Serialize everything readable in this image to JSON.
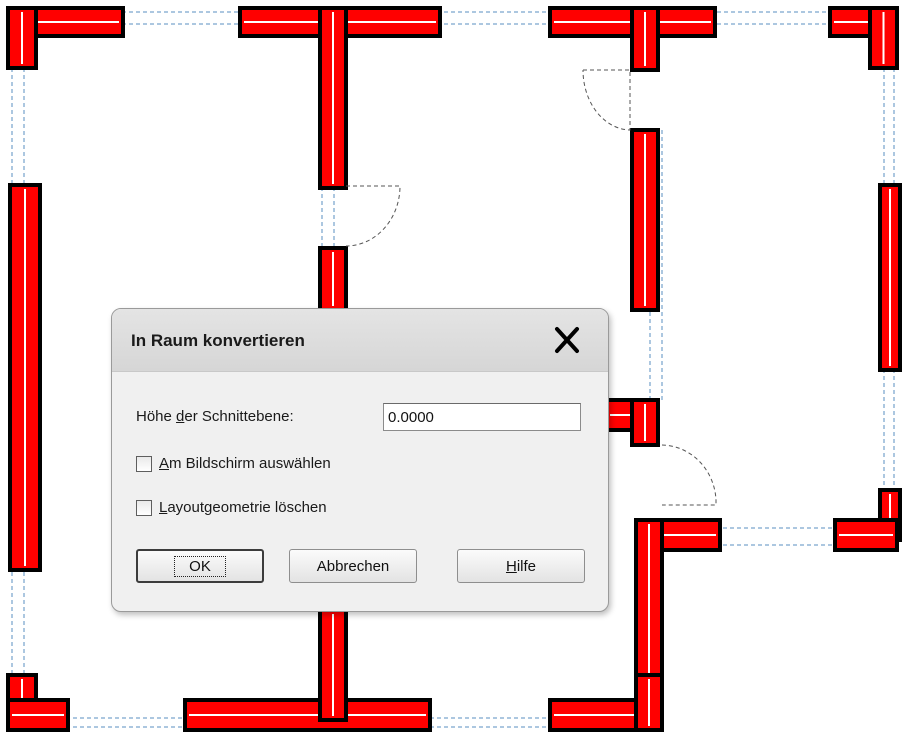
{
  "dialog": {
    "title": "In Raum konvertieren",
    "close_icon": "close-x-icon",
    "height_label_pre": "Höhe ",
    "height_label_u": "d",
    "height_label_post": "er Schnittebene:",
    "height_value": "0.0000",
    "select_on_screen_u": "A",
    "select_on_screen_rest": "m Bildschirm auswählen",
    "delete_layout_u": "L",
    "delete_layout_rest": "ayoutgeometrie löschen",
    "ok_label": "OK",
    "cancel_label": "Abbrechen",
    "help_u": "H",
    "help_rest": "ilfe"
  },
  "colors": {
    "wall_fill": "#ff0000",
    "wall_outline": "#000000",
    "dash_outline": "#5a8fc0",
    "door_swing": "#555555"
  }
}
